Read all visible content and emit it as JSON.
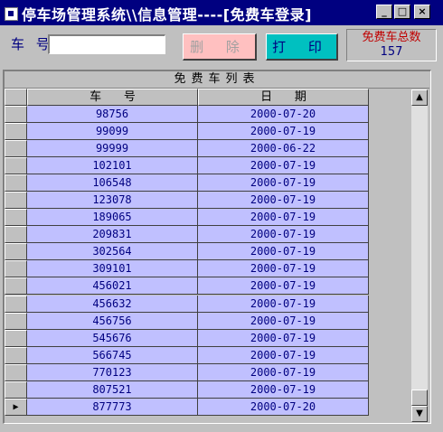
{
  "window": {
    "title": "停车场管理系统\\\\信息管理----[免费车登录]",
    "min_glyph": "_",
    "max_glyph": "□",
    "close_glyph": "×"
  },
  "form": {
    "car_no_label": "车 号",
    "car_no_value": "",
    "delete_label": "删 除",
    "print_label": "打 印",
    "total_label": "免费车总数",
    "total_value": "157"
  },
  "grid": {
    "caption": "免费车列表",
    "col_car_no": "车      号",
    "col_date": "日      期",
    "rows": [
      {
        "car_no": "98756",
        "date": "2000-07-20"
      },
      {
        "car_no": "99099",
        "date": "2000-07-19"
      },
      {
        "car_no": "99999",
        "date": "2000-06-22"
      },
      {
        "car_no": "102101",
        "date": "2000-07-19"
      },
      {
        "car_no": "106548",
        "date": "2000-07-19"
      },
      {
        "car_no": "123078",
        "date": "2000-07-19"
      },
      {
        "car_no": "189065",
        "date": "2000-07-19"
      },
      {
        "car_no": "209831",
        "date": "2000-07-19"
      },
      {
        "car_no": "302564",
        "date": "2000-07-19"
      },
      {
        "car_no": "309101",
        "date": "2000-07-19"
      },
      {
        "car_no": "456021",
        "date": "2000-07-19"
      },
      {
        "car_no": "456632",
        "date": "2000-07-19"
      },
      {
        "car_no": "456756",
        "date": "2000-07-19"
      },
      {
        "car_no": "545676",
        "date": "2000-07-19"
      },
      {
        "car_no": "566745",
        "date": "2000-07-19"
      },
      {
        "car_no": "770123",
        "date": "2000-07-19"
      },
      {
        "car_no": "807521",
        "date": "2000-07-19"
      },
      {
        "car_no": "877773",
        "date": "2000-07-20"
      }
    ],
    "current_row_marker": "▶",
    "scroll_up_glyph": "▲",
    "scroll_down_glyph": "▼"
  },
  "colors": {
    "title_bar": "#000080",
    "cell_bg": "#c0c0ff",
    "cell_text": "#000080",
    "delete_button_bg": "#ffc0c0",
    "print_button_bg": "#00c0c0",
    "total_label_color": "#c00000"
  },
  "icons": [
    "app-icon",
    "minimize-icon",
    "maximize-icon",
    "close-icon",
    "row-pointer-icon",
    "scroll-up-icon",
    "scroll-down-icon"
  ]
}
